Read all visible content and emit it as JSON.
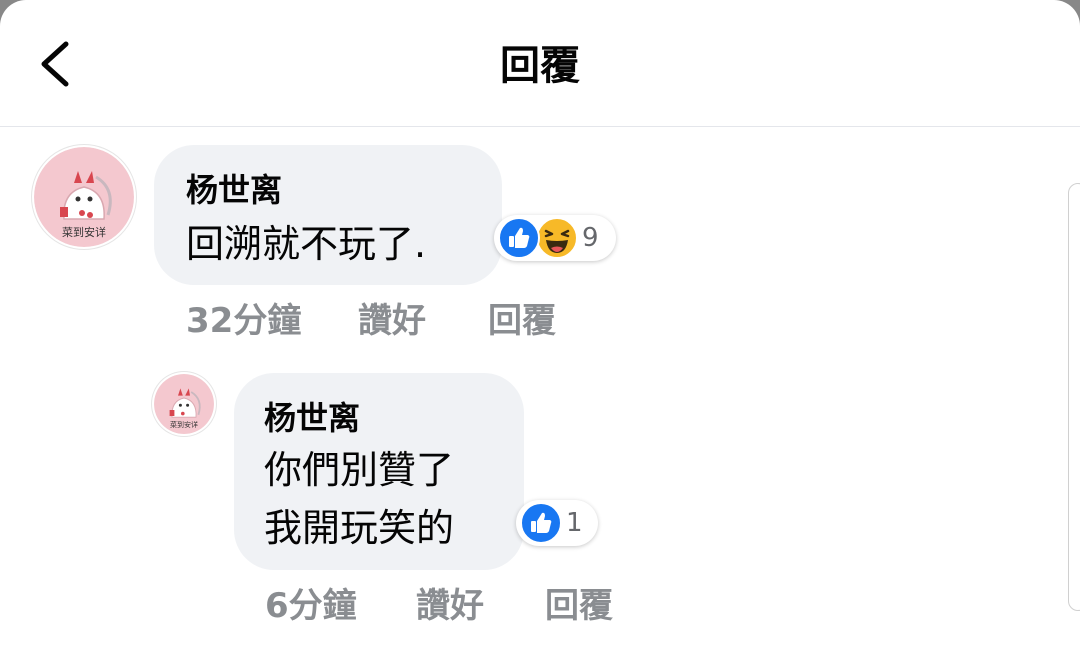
{
  "header": {
    "title": "回覆",
    "back_icon": "chevron-left-icon"
  },
  "comments": [
    {
      "author": "杨世离",
      "text_lines": [
        "回溯就不玩了."
      ],
      "avatar_caption": "菜到安详",
      "reactions": {
        "icons": [
          "like-icon",
          "haha-icon"
        ],
        "count": "9"
      },
      "time": "32分鐘",
      "like_label": "讚好",
      "reply_label": "回覆"
    },
    {
      "author": "杨世离",
      "text_lines": [
        "你們別贊了",
        "我開玩笑的"
      ],
      "avatar_caption": "菜到安详",
      "reactions": {
        "icons": [
          "like-icon"
        ],
        "count": "1"
      },
      "time": "6分鐘",
      "like_label": "讚好",
      "reply_label": "回覆"
    }
  ],
  "colors": {
    "like_blue": "#1877f2",
    "haha_yellow": "#f7b928",
    "bubble_bg": "#f0f2f5",
    "meta_gray": "#8a8d91",
    "avatar_pink": "#f4c8cf"
  }
}
